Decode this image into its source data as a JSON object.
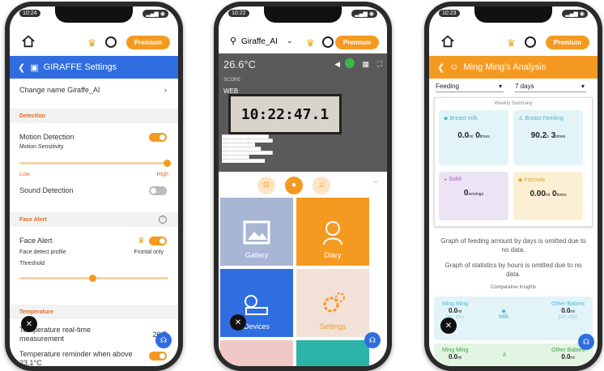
{
  "phone1": {
    "status_time": "10:24",
    "status_right": "",
    "premium_label": "Premium",
    "header_title": "GIRAFFE Settings",
    "change_name_label": "Change name",
    "change_name_value": "Giraffe_AI",
    "section_detection": "Detection",
    "motion_detection": "Motion Detection",
    "motion_sensitivity": "Motion Sensitivity",
    "slider_low": "Low",
    "slider_high": "High",
    "sound_detection": "Sound Detection",
    "section_face_alert": "Face Alert",
    "face_alert": "Face Alert",
    "face_detect_profile": "Face detect profile",
    "face_detect_value": "Frontal only",
    "threshold": "Threshold",
    "section_temperature": "Temperature",
    "temp_realtime": "Temperature real-time measurement",
    "temp_value": "26.7",
    "temp_reminder": "Temperature reminder when above",
    "temp_reminder_cut": "23.1°C",
    "motion_sensitivity_level": 1.0,
    "threshold_level": 0.47,
    "colors": {
      "accent": "#f59a21",
      "header": "#2f6de0",
      "section": "#e8681f"
    }
  },
  "phone2": {
    "status_time": "10:22",
    "device_name": "Giraffe_AI",
    "premium_label": "Premium",
    "temperature": "26.6°C",
    "clock_text": "10:22:47.1",
    "cam_line1": "SCORE",
    "cam_line2": "WEB",
    "tiles": [
      "Gallery",
      "Diary",
      "Devices",
      "Settings"
    ],
    "tile_colors": [
      "#a8b6d4",
      "#f59a21",
      "#2f6de0",
      "#f3e0d7"
    ]
  },
  "phone3": {
    "status_time": "10:23",
    "premium_label": "Premium",
    "header_title": "Ming Ming's Analysis",
    "filter_type": "Feeding",
    "filter_range": "7 days",
    "weekly_summary": "Weekly Summary",
    "breast_milk": "Breast milk",
    "breast_milk_value": "0.0",
    "breast_milk_unit": "ml",
    "breast_milk_times": "0",
    "breast_milk_times_unit": "times",
    "breast_feeding": "Breast Feeding",
    "breast_feeding_value": "90.2",
    "breast_feeding_unit": "h",
    "breast_feeding_times": "3",
    "breast_feeding_times_unit": "times",
    "solid": "Solid",
    "solid_value": "0",
    "solid_unit": "servings",
    "formula": "Formula",
    "formula_value": "0.00",
    "formula_unit": "ml",
    "formula_times": "0",
    "formula_times_unit": "times",
    "graph_days_note": "Graph of feeding amount by days is omitted due to no data.",
    "graph_hours_note": "Graph of statistics by hours is omitted due to no data.",
    "comparative": "Comparative Insights",
    "ming_ming": "Ming Ming",
    "other_babies": "Other Babies",
    "milk_label": "Milk",
    "compare_value": "0.0",
    "compare_unit": "ml",
    "per_day": "per day"
  }
}
